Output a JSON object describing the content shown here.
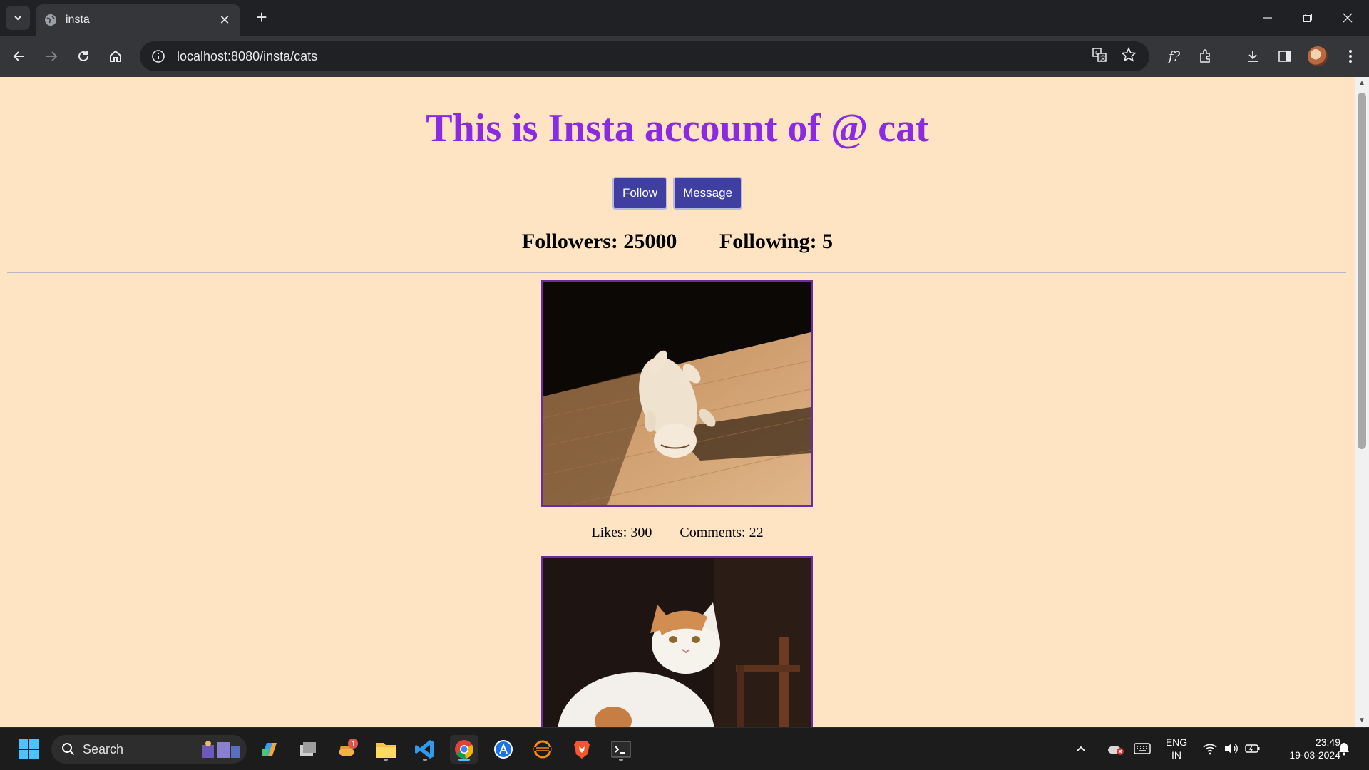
{
  "browser": {
    "tab_title": "insta",
    "url": "localhost:8080/insta/cats"
  },
  "page": {
    "title": "This is Insta account of @ cat",
    "follow_label": "Follow",
    "message_label": "Message",
    "followers": "Followers: 25000",
    "following": "Following: 5",
    "posts": [
      {
        "likes": "Likes: 300",
        "comments": "Comments: 22"
      }
    ]
  },
  "taskbar": {
    "search_placeholder": "Search",
    "notification_count": "1",
    "lang_top": "ENG",
    "lang_bottom": "IN",
    "time": "23:49",
    "date": "19-03-2024"
  }
}
